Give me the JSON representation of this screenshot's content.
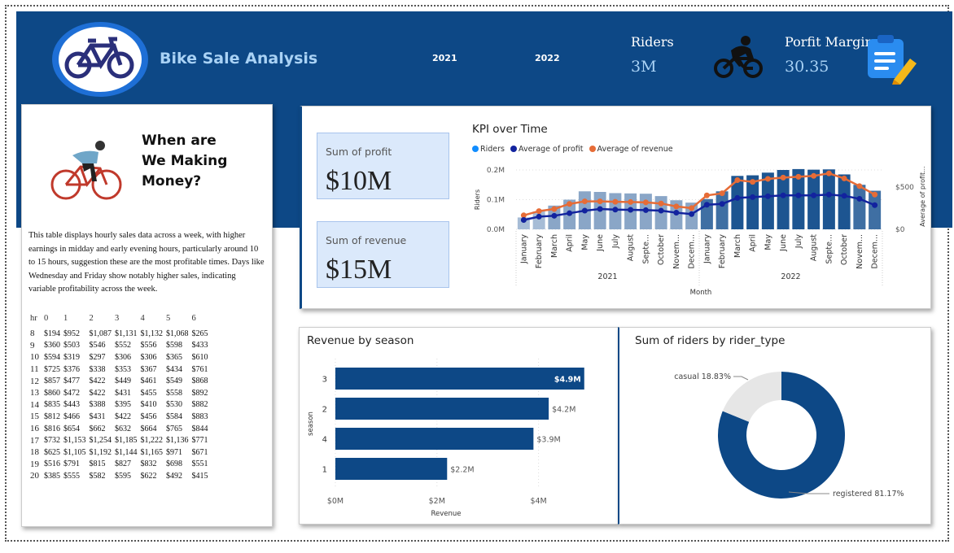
{
  "header": {
    "title": "Bike Sale Analysis",
    "year_filters": [
      "2021",
      "2022"
    ],
    "riders_label": "Riders",
    "riders_value": "3M",
    "margin_label": "Porfit Margin",
    "margin_value": "30.35",
    "icons": {
      "logo": "bicycle-icon",
      "cyclist": "cyclist-icon",
      "clipboard": "clipboard-pencil-icon"
    }
  },
  "money_panel": {
    "heading": [
      "When are",
      "We Making",
      "Money?"
    ],
    "description": "This table displays hourly sales data across a week, with higher earnings in midday and early evening hours, particularly around 10 to 15 hours, suggestion these are the most profitable times. Days like Wednesday and Friday show notably higher sales, indicating variable profitability across the week.",
    "table": {
      "columns": [
        "hr",
        "0",
        "1",
        "2",
        "3",
        "4",
        "5",
        "6"
      ],
      "rows": [
        [
          "8",
          "$194",
          "$952",
          "$1,087",
          "$1,131",
          "$1,132",
          "$1,068",
          "$265"
        ],
        [
          "9",
          "$360",
          "$503",
          "$546",
          "$552",
          "$556",
          "$598",
          "$433"
        ],
        [
          "10",
          "$594",
          "$319",
          "$297",
          "$306",
          "$306",
          "$365",
          "$610"
        ],
        [
          "11",
          "$725",
          "$376",
          "$338",
          "$353",
          "$367",
          "$434",
          "$761"
        ],
        [
          "12",
          "$857",
          "$477",
          "$422",
          "$449",
          "$461",
          "$549",
          "$868"
        ],
        [
          "13",
          "$860",
          "$472",
          "$422",
          "$431",
          "$455",
          "$558",
          "$892"
        ],
        [
          "14",
          "$835",
          "$443",
          "$388",
          "$395",
          "$410",
          "$530",
          "$882"
        ],
        [
          "15",
          "$812",
          "$466",
          "$431",
          "$422",
          "$456",
          "$584",
          "$883"
        ],
        [
          "16",
          "$816",
          "$654",
          "$662",
          "$632",
          "$664",
          "$765",
          "$844"
        ],
        [
          "17",
          "$732",
          "$1,153",
          "$1,254",
          "$1,185",
          "$1,222",
          "$1,136",
          "$771"
        ],
        [
          "18",
          "$625",
          "$1,105",
          "$1,192",
          "$1,144",
          "$1,165",
          "$971",
          "$671"
        ],
        [
          "19",
          "$516",
          "$791",
          "$815",
          "$827",
          "$832",
          "$698",
          "$551"
        ],
        [
          "20",
          "$385",
          "$555",
          "$582",
          "$595",
          "$622",
          "$492",
          "$415"
        ]
      ]
    }
  },
  "kpi_cards": {
    "profit_label": "Sum of profit",
    "profit_value": "$10M",
    "revenue_label": "Sum of revenue",
    "revenue_value": "$15M"
  },
  "chart_data": [
    {
      "type": "bar",
      "title": "KPI over Time",
      "legend": [
        "Riders",
        "Average of profit",
        "Average of revenue"
      ],
      "legend_position": "top-left",
      "legend_colors": [
        "#118dff",
        "#12239e",
        "#e66c37"
      ],
      "xlabel": "Month",
      "ylabel": "Riders",
      "y2label": "Average of profit...",
      "ylim": [
        0,
        0.2
      ],
      "y_ticks": [
        "0.0M",
        "0.1M",
        "0.2M"
      ],
      "y2_ticks": [
        "$0",
        "$500"
      ],
      "y2lim": [
        0,
        700
      ],
      "year_groups": [
        "2021",
        "2022"
      ],
      "categories": [
        "January",
        "February",
        "March",
        "April",
        "May",
        "June",
        "July",
        "August",
        "Septe...",
        "October",
        "Novem...",
        "Decem...",
        "January",
        "February",
        "March",
        "April",
        "May",
        "June",
        "July",
        "August",
        "Septe...",
        "October",
        "Novem...",
        "Decem..."
      ],
      "series": [
        {
          "name": "Riders",
          "kind": "bar",
          "values": [
            0.04,
            0.06,
            0.08,
            0.1,
            0.128,
            0.126,
            0.122,
            0.121,
            0.12,
            0.112,
            0.098,
            0.09,
            0.102,
            0.128,
            0.18,
            0.182,
            0.191,
            0.2,
            0.203,
            0.201,
            0.202,
            0.185,
            0.15,
            0.13
          ]
        },
        {
          "name": "Average of profit",
          "kind": "line",
          "values": [
            110,
            150,
            160,
            190,
            220,
            240,
            232,
            230,
            226,
            220,
            196,
            180,
            290,
            300,
            370,
            380,
            390,
            400,
            400,
            400,
            410,
            395,
            360,
            285
          ]
        },
        {
          "name": "Average of revenue",
          "kind": "line",
          "values": [
            165,
            215,
            240,
            300,
            330,
            330,
            325,
            322,
            318,
            305,
            270,
            250,
            400,
            425,
            580,
            560,
            595,
            610,
            620,
            630,
            660,
            600,
            510,
            410
          ]
        }
      ]
    },
    {
      "type": "bar",
      "orientation": "horizontal",
      "title": "Revenue by season",
      "categories": [
        "3",
        "2",
        "4",
        "1"
      ],
      "values": [
        4.9,
        4.2,
        3.9,
        2.2
      ],
      "labels": [
        "$4.9M",
        "$4.2M",
        "$3.9M",
        "$2.2M"
      ],
      "xlabel": "Revenue",
      "ylabel": "season",
      "xlim": [
        0,
        5
      ],
      "x_ticks": [
        "$0M",
        "$2M",
        "$4M"
      ],
      "color": "#0d4886"
    },
    {
      "type": "pie",
      "donut": true,
      "title": "Sum of riders by rider_type",
      "categories": [
        "registered",
        "casual"
      ],
      "values": [
        81.17,
        18.83
      ],
      "labels": [
        "registered 81.17%",
        "casual 18.83%"
      ],
      "colors": [
        "#0d4886",
        "#e6e6e6"
      ]
    }
  ]
}
